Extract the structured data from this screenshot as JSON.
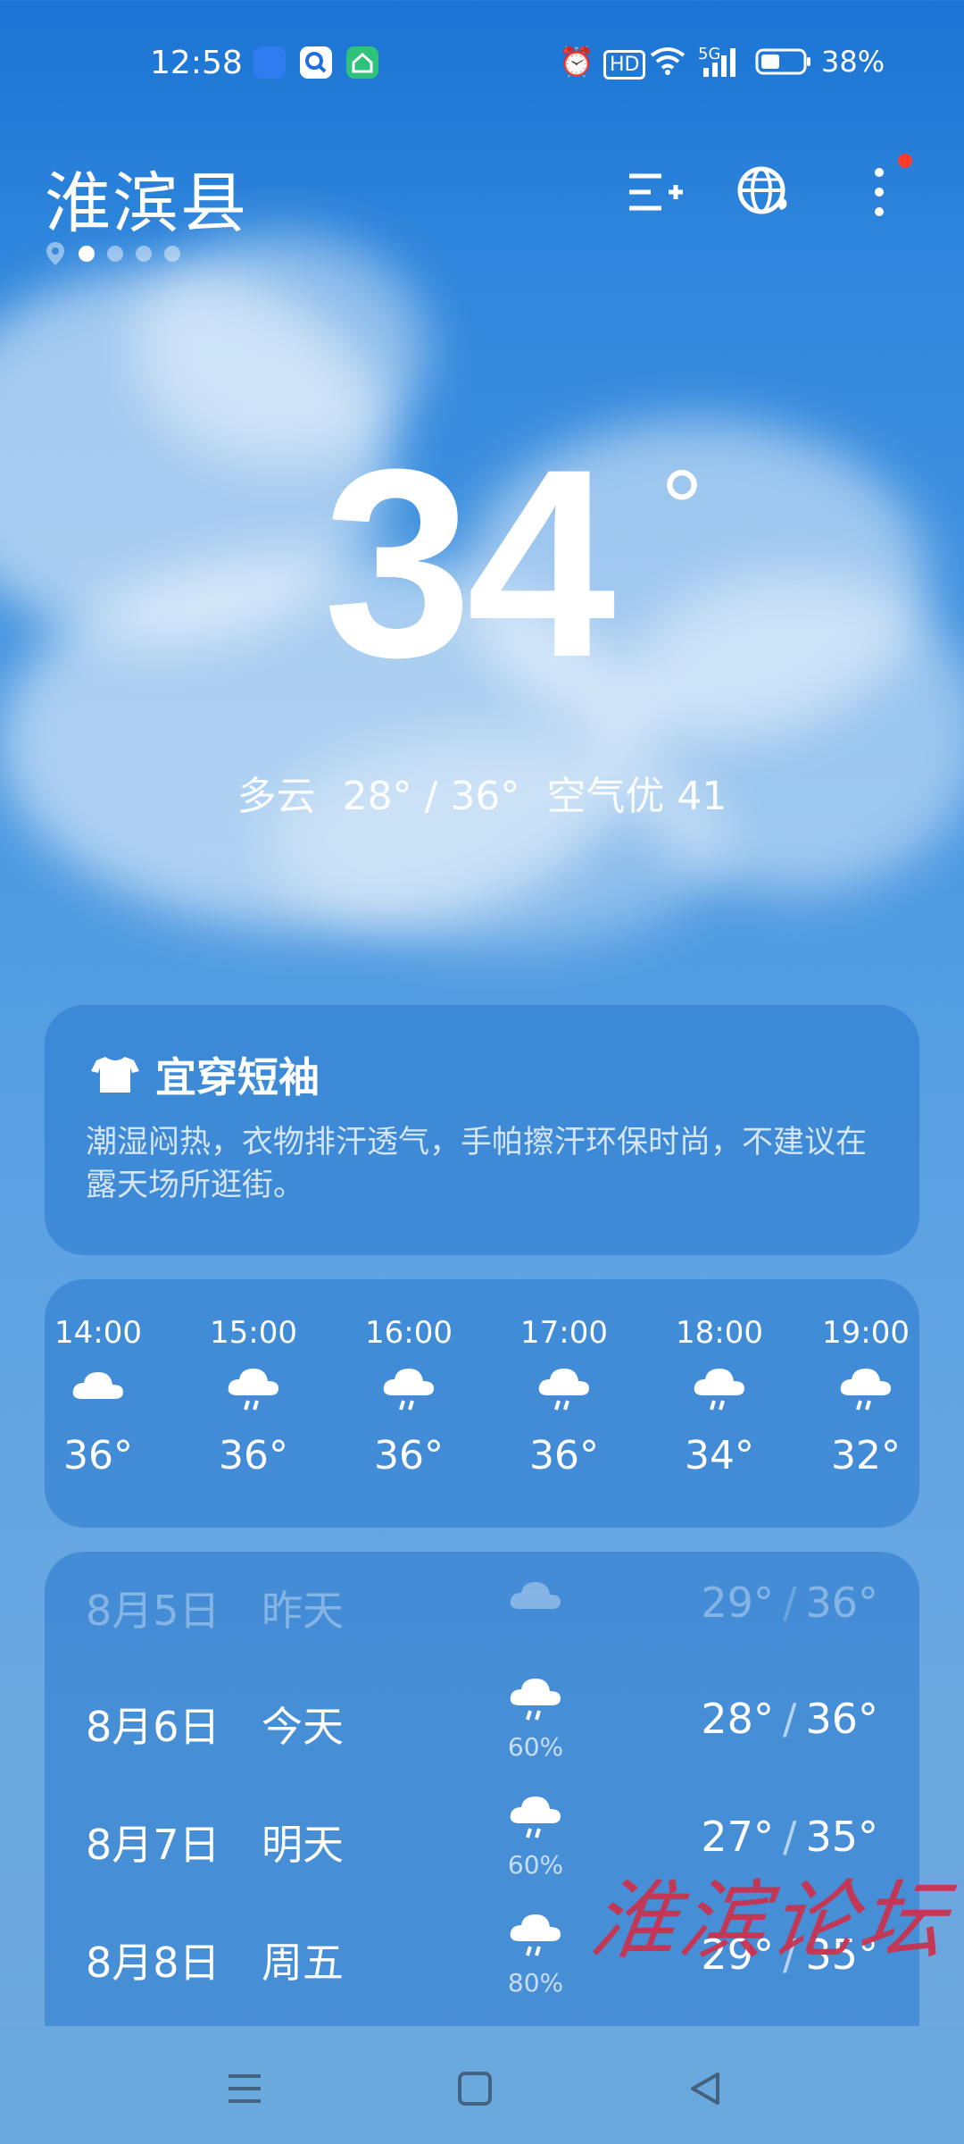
{
  "status_bar": {
    "time": "12:58",
    "battery_percent": "38%",
    "network_label": "5G",
    "hd_label": "HD"
  },
  "header": {
    "city": "淮滨县",
    "page_count": 4,
    "active_page": 0
  },
  "current": {
    "temperature": "34",
    "degree_symbol": "°",
    "condition": "多云",
    "low_high": "28° / 36°",
    "air_quality": "空气优 41"
  },
  "advice": {
    "title": "宜穿短袖",
    "body": "潮湿闷热，衣物排汗透气，手帕擦汗环保时尚，不建议在露天场所逛街。"
  },
  "hourly": [
    {
      "time": "14:00",
      "icon": "cloud-icon",
      "temp": "36°"
    },
    {
      "time": "15:00",
      "icon": "rain-cloud-icon",
      "temp": "36°"
    },
    {
      "time": "16:00",
      "icon": "rain-cloud-icon",
      "temp": "36°"
    },
    {
      "time": "17:00",
      "icon": "rain-cloud-icon",
      "temp": "36°"
    },
    {
      "time": "18:00",
      "icon": "rain-cloud-icon",
      "temp": "34°"
    },
    {
      "time": "19:00",
      "icon": "rain-cloud-icon",
      "temp": "32°"
    }
  ],
  "daily": [
    {
      "date": "8月5日",
      "day": "昨天",
      "icon": "cloud-icon",
      "precip": "",
      "low": "29°",
      "high": "36°"
    },
    {
      "date": "8月6日",
      "day": "今天",
      "icon": "rain-cloud-icon",
      "precip": "60%",
      "low": "28°",
      "high": "36°"
    },
    {
      "date": "8月7日",
      "day": "明天",
      "icon": "rain-cloud-icon",
      "precip": "60%",
      "low": "27°",
      "high": "35°"
    },
    {
      "date": "8月8日",
      "day": "周五",
      "icon": "rain-cloud-icon",
      "precip": "80%",
      "low": "29°",
      "high": "35°"
    }
  ],
  "watermark": "淮滨论坛",
  "colors": {
    "sky_top": "#1b74d4",
    "sky_bottom": "#6ea9de",
    "card": "#2878cd",
    "notification_dot": "#ff3b30",
    "watermark": "#c9334f"
  }
}
